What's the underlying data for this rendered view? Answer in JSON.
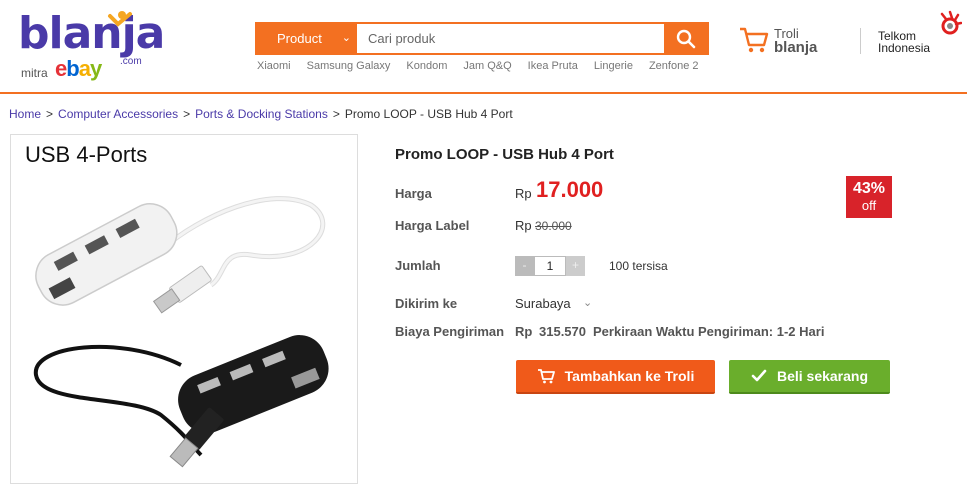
{
  "header": {
    "logo": {
      "brand": "blanja",
      "com": ".com",
      "mitra": "mitra",
      "ebay": [
        "e",
        "b",
        "a",
        "y"
      ]
    },
    "search": {
      "category": "Product",
      "placeholder": "Cari produk",
      "suggestions": [
        "Xiaomi",
        "Samsung Galaxy",
        "Kondom",
        "Jam Q&Q",
        "Ikea Pruta",
        "Lingerie",
        "Zenfone 2"
      ]
    },
    "cart": {
      "line1": "Troli",
      "line2": "blanja"
    },
    "partner": {
      "line1": "Telkom",
      "line2": "Indonesia"
    },
    "accent_color": "#f37021"
  },
  "breadcrumb": [
    "Home",
    "Computer Accessories",
    "Ports & Docking Stations",
    "Promo LOOP - USB Hub 4 Port"
  ],
  "product": {
    "image_caption": "USB 4-Ports",
    "title": "Promo LOOP - USB Hub 4 Port",
    "price_label": "Harga",
    "currency": "Rp",
    "price": "17.000",
    "list_price_label": "Harga Label",
    "list_price": "30.000",
    "discount": {
      "percent": "43%",
      "text": "off"
    },
    "qty_label": "Jumlah",
    "qty_minus": "-",
    "qty_value": "1",
    "qty_plus": "+",
    "stock": "100 tersisa",
    "ship_label": "Dikirim ke",
    "ship_city": "Surabaya",
    "ship_cost_label": "Biaya Pengiriman",
    "ship_cost": "315.570",
    "eta": "Perkiraan Waktu Pengiriman: 1-2 Hari",
    "add_to_cart": "Tambahkan ke Troli",
    "buy_now": "Beli sekarang"
  }
}
